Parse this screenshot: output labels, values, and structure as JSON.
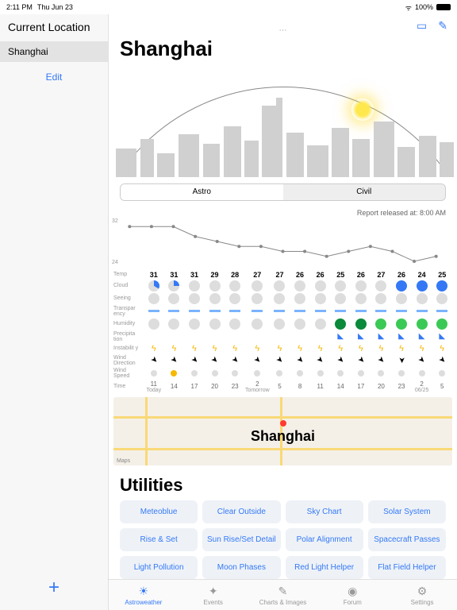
{
  "status": {
    "time": "2:11 PM",
    "date": "Thu Jun 23",
    "wifi": "᯾",
    "battery": "100%"
  },
  "sidebar": {
    "header": "Current Location",
    "items": [
      "Shanghai"
    ],
    "edit": "Edit",
    "add": "+"
  },
  "header": {
    "title": "Shanghai",
    "chat_icon": "chat",
    "edit_icon": "edit"
  },
  "segmented": {
    "astro": "Astro",
    "civil": "Civil"
  },
  "report": "Report released at: 8:00 AM",
  "chart_data": {
    "type": "line",
    "ylabel": "Temp",
    "ylim": [
      24,
      32
    ],
    "x": [
      0,
      1,
      2,
      3,
      4,
      5,
      6,
      7,
      8,
      9,
      10,
      11,
      12,
      13,
      14
    ],
    "values": [
      31,
      31,
      31,
      29,
      28,
      27,
      27,
      26,
      26,
      25,
      26,
      27,
      26,
      24,
      25
    ]
  },
  "rows": {
    "temp": {
      "label": "Temp",
      "values": [
        "31",
        "31",
        "31",
        "29",
        "28",
        "27",
        "27",
        "26",
        "26",
        "25",
        "26",
        "27",
        "26",
        "24",
        "25"
      ]
    },
    "cloud": {
      "label": "Cloud",
      "classes": [
        "pie",
        "pie2",
        "gray",
        "gray",
        "gray",
        "gray",
        "gray",
        "gray",
        "gray",
        "gray",
        "gray",
        "gray",
        "blue",
        "blue",
        "blue"
      ]
    },
    "seeing": {
      "label": "Seeing",
      "classes": [
        "gray",
        "gray",
        "gray",
        "gray",
        "gray",
        "gray",
        "gray",
        "gray",
        "gray",
        "gray",
        "gray",
        "gray",
        "gray",
        "gray",
        "gray"
      ]
    },
    "transparency": {
      "label": "Transpar\nency",
      "bars": [
        1,
        1,
        1,
        1,
        1,
        1,
        1,
        1,
        1,
        1,
        1,
        1,
        1,
        1,
        1
      ]
    },
    "humidity": {
      "label": "Humidity",
      "classes": [
        "gray",
        "gray",
        "gray",
        "gray",
        "gray",
        "gray",
        "gray",
        "gray",
        "gray",
        "dgreen",
        "dgreen",
        "green",
        "green",
        "green",
        "green"
      ]
    },
    "precipitation": {
      "label": "Precipita\ntion",
      "show": [
        0,
        0,
        0,
        0,
        0,
        0,
        0,
        0,
        0,
        1,
        1,
        1,
        1,
        1,
        1
      ]
    },
    "instability": {
      "label": "Instabilit\ny",
      "bolts": [
        1,
        1,
        1,
        1,
        1,
        1,
        1,
        1,
        1,
        1,
        1,
        1,
        1,
        1,
        1
      ]
    },
    "windDir": {
      "label": "Wind\nDirection",
      "angles": [
        45,
        45,
        45,
        45,
        45,
        45,
        45,
        45,
        45,
        45,
        45,
        45,
        90,
        45,
        45
      ]
    },
    "windSpeed": {
      "label": "Wind\nSpeed",
      "classes": [
        "gray",
        "gold",
        "gray",
        "gray",
        "gray",
        "gray",
        "gray",
        "gray",
        "gray",
        "gray",
        "gray",
        "gray",
        "gray",
        "gray",
        "gray"
      ]
    },
    "time": {
      "label": "Time",
      "values": [
        "11",
        "14",
        "17",
        "20",
        "23",
        "2",
        "5",
        "8",
        "11",
        "14",
        "17",
        "20",
        "23",
        "2",
        "5"
      ],
      "days": {
        "0": "Today",
        "5": "Tomorrow",
        "13": "06/25"
      }
    }
  },
  "map": {
    "city": "Shanghai",
    "attr": "Maps"
  },
  "utilities": {
    "title": "Utilities",
    "items": [
      "Meteoblue",
      "Clear Outside",
      "Sky Chart",
      "Solar System",
      "Rise & Set",
      "Sun Rise/Set Detail",
      "Polar Alignment",
      "Spacecraft Passes",
      "Light Pollution",
      "Moon Phases",
      "Red Light Helper",
      "Flat Field Helper"
    ]
  },
  "tabs": [
    {
      "label": "Astroweather",
      "icon": "☀"
    },
    {
      "label": "Events",
      "icon": "✦"
    },
    {
      "label": "Charts & Images",
      "icon": "✎"
    },
    {
      "label": "Forum",
      "icon": "◉"
    },
    {
      "label": "Settings",
      "icon": "⚙"
    }
  ]
}
